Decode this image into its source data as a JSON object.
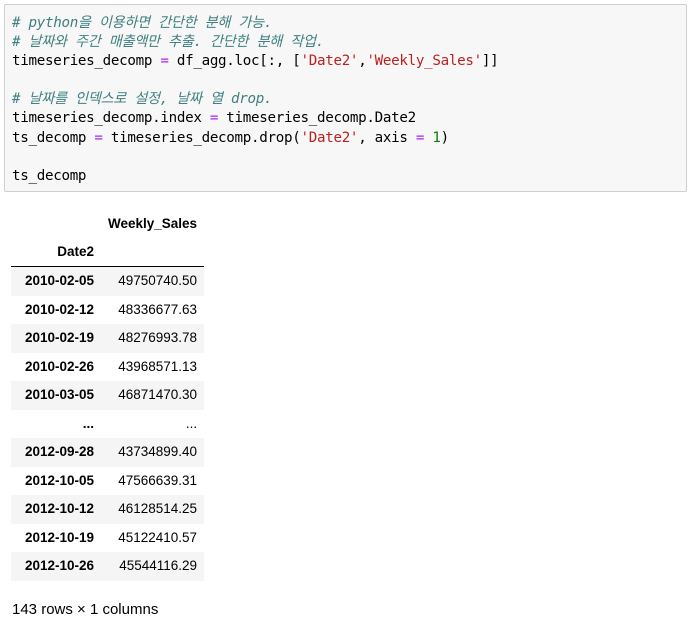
{
  "code_cell": {
    "lines": {
      "l1": {
        "comment": "# python을 이용하면 간단한 분해 가능."
      },
      "l2": {
        "comment": "# 날짜와 주간 매출액만 추출. 간단한 분해 작업."
      },
      "l3": {
        "lhs": "timeseries_decomp ",
        "op": "=",
        "mid": " df_agg.loc[:, [",
        "str1": "'Date2'",
        "comma": ",",
        "str2": "'Weekly_Sales'",
        "end": "]]"
      },
      "l5": {
        "comment": "# 날짜를 인덱스로 설정, 날짜 열 drop."
      },
      "l6": {
        "lhs": "timeseries_decomp.index ",
        "op": "=",
        "rhs": " timeseries_decomp.Date2"
      },
      "l7": {
        "lhs": "ts_decomp ",
        "op": "=",
        "mid": " timeseries_decomp.drop(",
        "str1": "'Date2'",
        "mid2": ", axis ",
        "op2": "=",
        "sp": " ",
        "num": "1",
        "end": ")"
      },
      "l9": {
        "text": "ts_decomp"
      }
    }
  },
  "dataframe": {
    "column_header": "Weekly_Sales",
    "index_name": "Date2",
    "rows": [
      {
        "index": "2010-02-05",
        "value": "49750740.50"
      },
      {
        "index": "2010-02-12",
        "value": "48336677.63"
      },
      {
        "index": "2010-02-19",
        "value": "48276993.78"
      },
      {
        "index": "2010-02-26",
        "value": "43968571.13"
      },
      {
        "index": "2010-03-05",
        "value": "46871470.30"
      },
      {
        "index": "...",
        "value": "..."
      },
      {
        "index": "2012-09-28",
        "value": "43734899.40"
      },
      {
        "index": "2012-10-05",
        "value": "47566639.31"
      },
      {
        "index": "2012-10-12",
        "value": "46128514.25"
      },
      {
        "index": "2012-10-19",
        "value": "45122410.57"
      },
      {
        "index": "2012-10-26",
        "value": "45544116.29"
      }
    ],
    "shape_note": "143 rows × 1 columns"
  },
  "colors": {
    "comment": "#408080",
    "operator": "#aa22ff",
    "string": "#ba2121",
    "number": "#008000",
    "code_background": "#f7f7f7",
    "striped_row": "#f5f5f5"
  }
}
